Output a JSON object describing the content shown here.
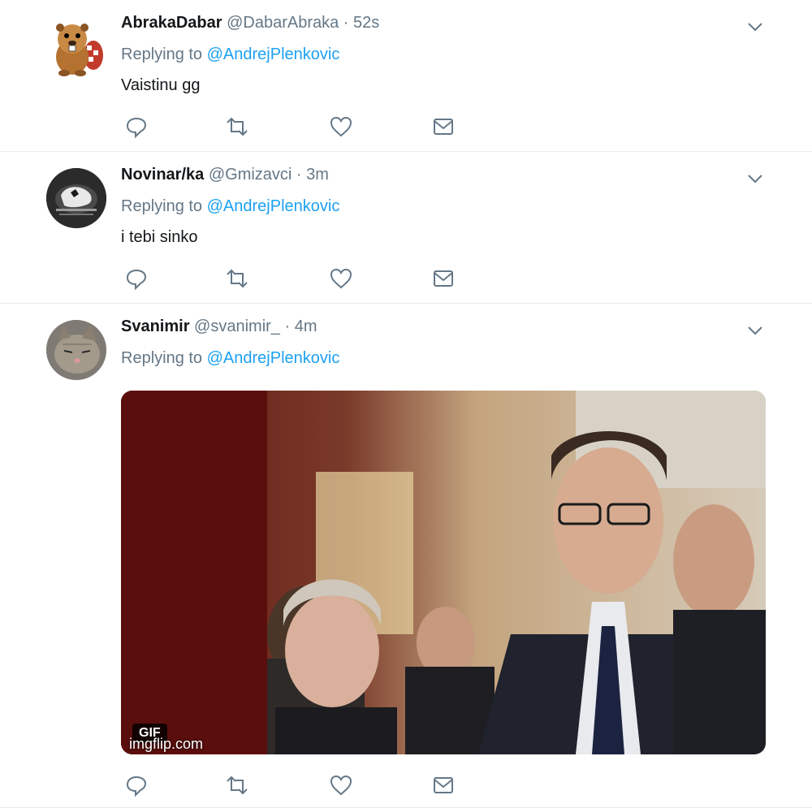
{
  "tweets": [
    {
      "name": "AbrakaDabar",
      "handle": "@DabarAbraka",
      "separator": "·",
      "time": "52s",
      "replying_prefix": "Replying to",
      "replying_to": "@AndrejPlenkovic",
      "text": "Vaistinu gg"
    },
    {
      "name": "Novinar/ka",
      "handle": "@Gmizavci",
      "separator": "·",
      "time": "3m",
      "replying_prefix": "Replying to",
      "replying_to": "@AndrejPlenkovic",
      "text": "i tebi sinko"
    },
    {
      "name": "Svanimir",
      "handle": "@svanimir_",
      "separator": "·",
      "time": "4m",
      "replying_prefix": "Replying to",
      "replying_to": "@AndrejPlenkovic",
      "media_badge": "GIF",
      "media_watermark": "imgflip.com"
    }
  ],
  "icons": {
    "more": "chevron-down-icon",
    "reply": "reply-icon",
    "retweet": "retweet-icon",
    "like": "heart-icon",
    "dm": "envelope-icon"
  },
  "colors": {
    "link": "#1da1f2",
    "muted": "#657786",
    "text": "#14171a",
    "divider": "#e6ecf0"
  }
}
